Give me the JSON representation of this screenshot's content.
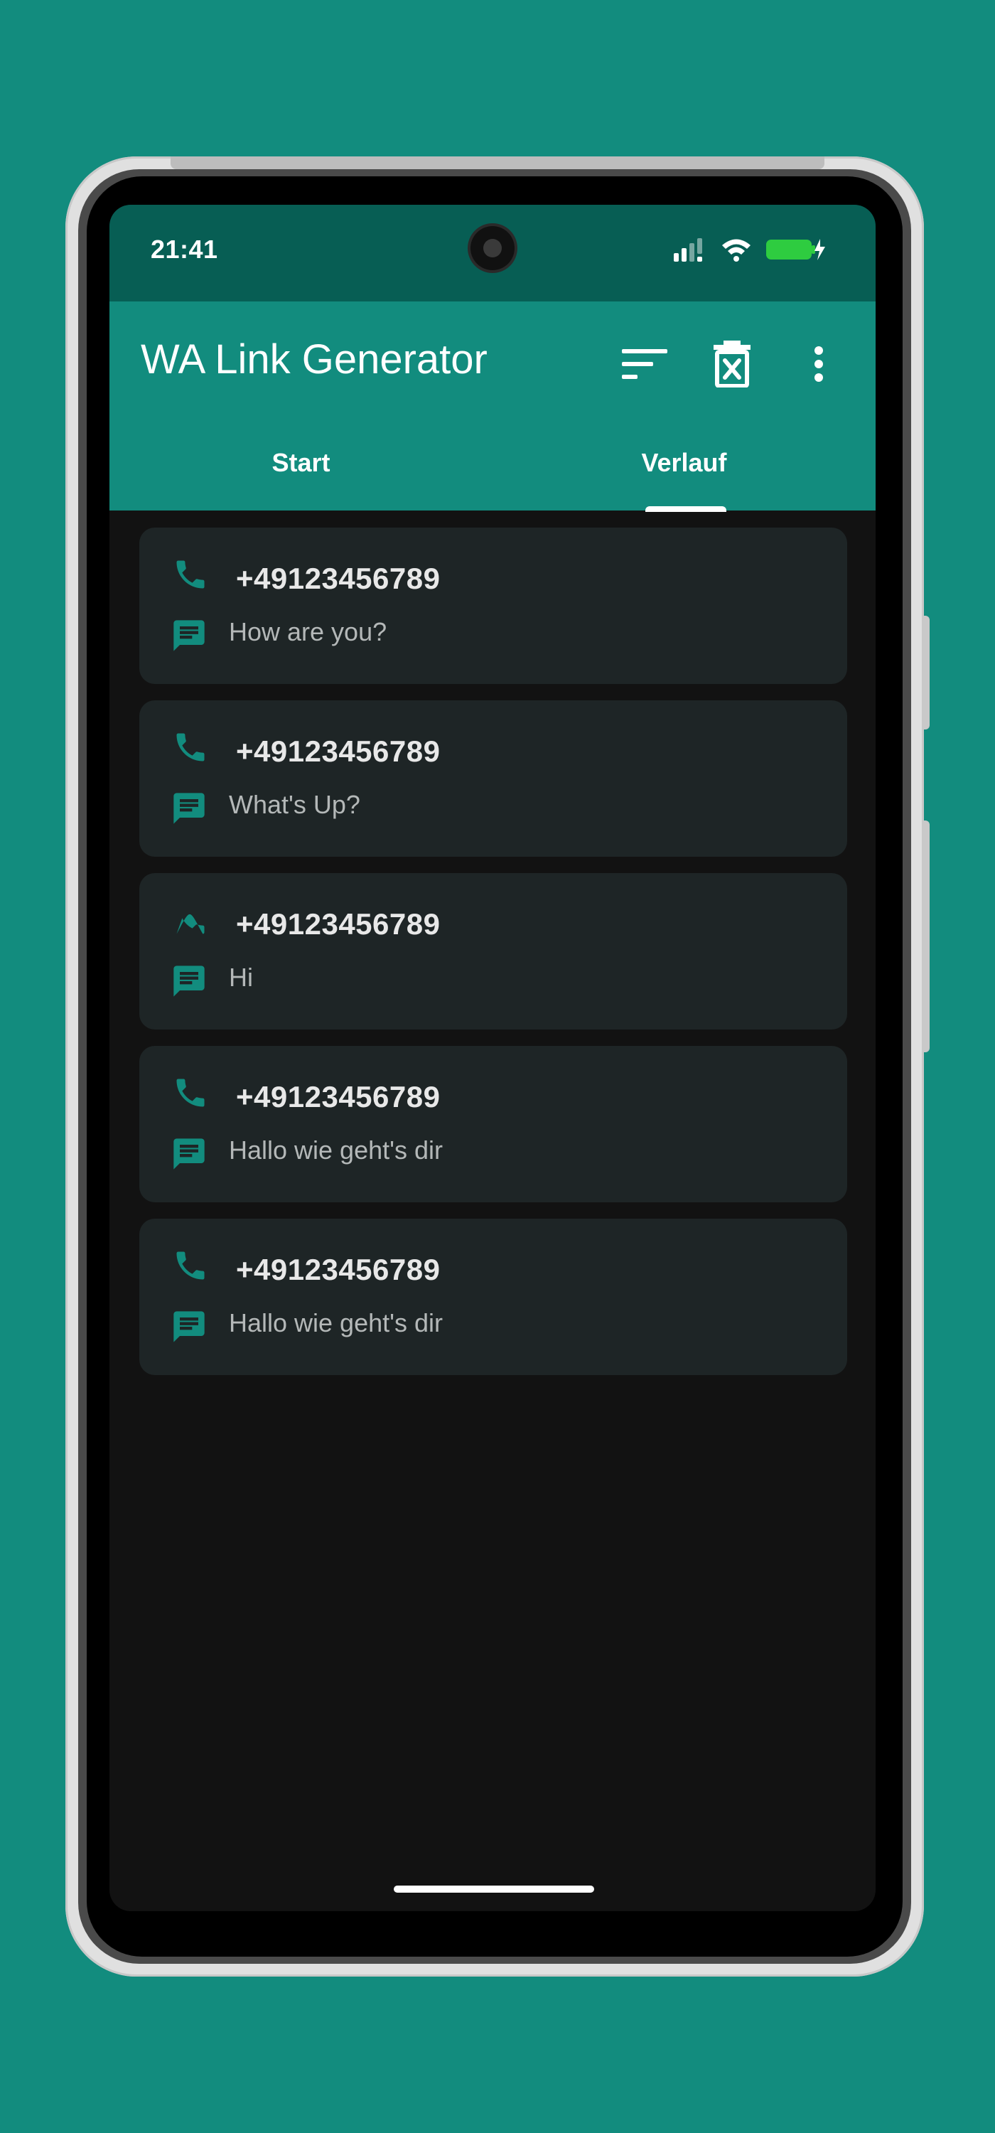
{
  "status_bar": {
    "time": "21:41",
    "icons": [
      "signal-icon",
      "wifi-icon",
      "battery-charging-icon"
    ],
    "battery_color": "#2ecc40"
  },
  "app_bar": {
    "title": "WA Link Generator",
    "actions": [
      "sort-icon",
      "delete-all-icon",
      "more-vert-icon"
    ]
  },
  "tabs": [
    {
      "label": "Start",
      "selected": false
    },
    {
      "label": "Verlauf",
      "selected": true
    }
  ],
  "history": [
    {
      "number": "+49123456789",
      "message": "How are you?"
    },
    {
      "number": "+49123456789",
      "message": "What's Up?"
    },
    {
      "number": "+49123456789",
      "message": "Hi"
    },
    {
      "number": "+49123456789",
      "message": "Hallo wie geht's dir"
    },
    {
      "number": "+49123456789",
      "message": "Hallo wie geht's dir"
    }
  ],
  "colors": {
    "primary": "#128c7e",
    "primary_dark": "#075e54",
    "background": "#121212",
    "card": "#1e2526",
    "icon_accent": "#128c7e"
  }
}
